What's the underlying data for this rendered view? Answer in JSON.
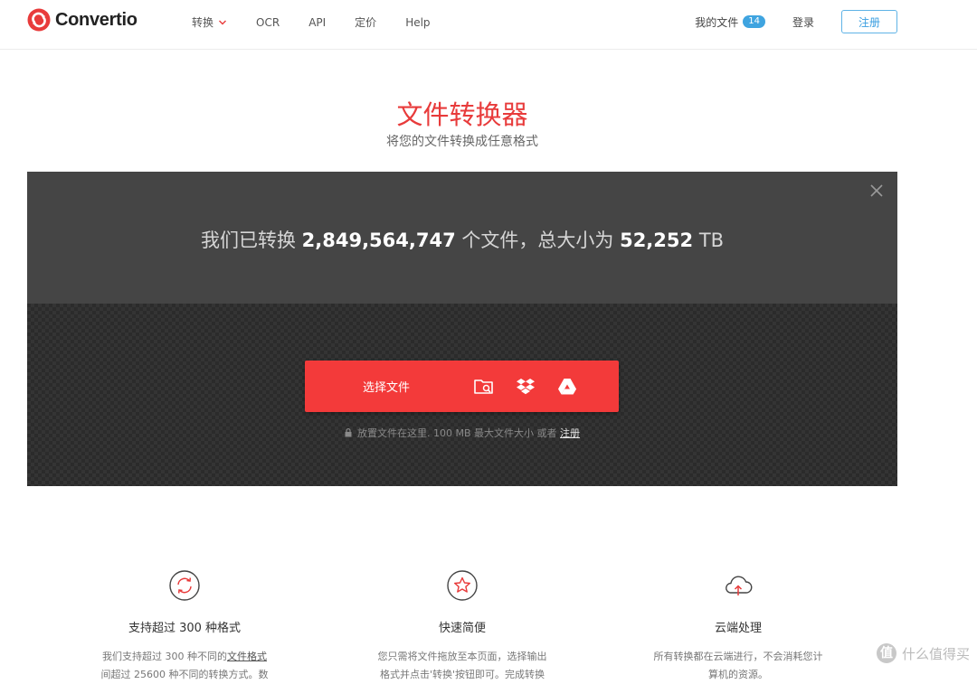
{
  "brand": {
    "name": "Convertio",
    "accent": "#e83b3b"
  },
  "nav": [
    {
      "label": "转换",
      "has_dropdown": true
    },
    {
      "label": "OCR"
    },
    {
      "label": "API"
    },
    {
      "label": "定价"
    },
    {
      "label": "Help"
    }
  ],
  "header_right": {
    "my_files": "我的文件",
    "files_count": "14",
    "login": "登录",
    "register": "注册"
  },
  "hero": {
    "title": "文件转换器",
    "subtitle": "将您的文件转换成任意格式"
  },
  "stats": {
    "prefix": "我们已转换",
    "files": "2,849,564,747",
    "mid": "个文件，总大小为",
    "size": "52,252",
    "unit": "TB"
  },
  "upload": {
    "choose_label": "选择文件",
    "sources": [
      "folder-search-icon",
      "dropbox-icon",
      "google-drive-icon"
    ],
    "hint_text": "放置文件在这里. 100 MB 最大文件大小 或者",
    "hint_link": "注册"
  },
  "features": [
    {
      "icon": "sync-icon",
      "title": "支持超过 300 种格式",
      "desc_a": "我们支持超过 300 种不同的",
      "desc_link": "文件格式",
      "desc_b": "间超过 25600 种不同的转换方式。数"
    },
    {
      "icon": "star-icon",
      "title": "快速简便",
      "desc_a": "您只需将文件拖放至本页面，选择输出",
      "desc_b": "格式并点击'转换'按钮即可。完成转换"
    },
    {
      "icon": "cloud-upload-icon",
      "title": "云端处理",
      "desc_a": "所有转换都在云端进行，不会消耗您计",
      "desc_b": "算机的资源。"
    }
  ],
  "watermark": {
    "text": "什么值得买",
    "mark": "值"
  }
}
